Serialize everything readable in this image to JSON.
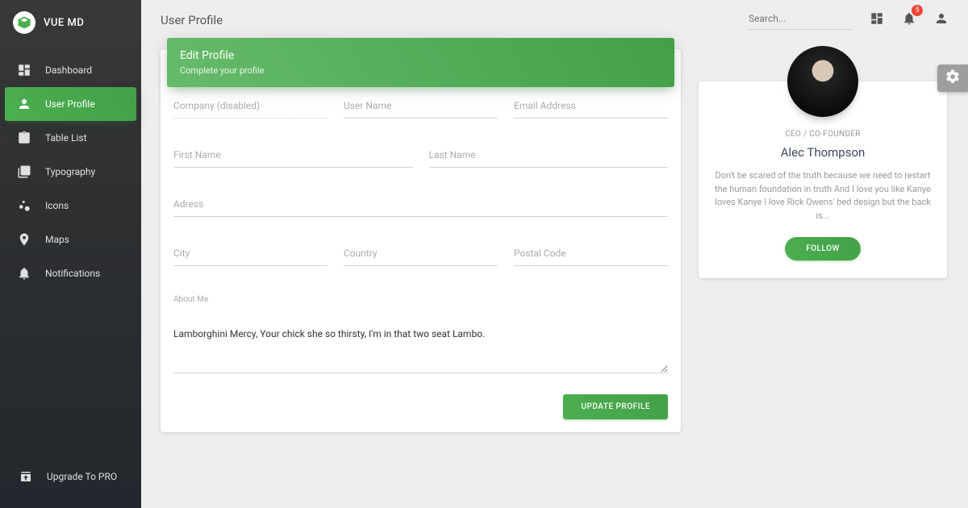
{
  "brand": {
    "name": "VUE MD"
  },
  "nav": {
    "items": [
      {
        "label": "Dashboard"
      },
      {
        "label": "User Profile"
      },
      {
        "label": "Table List"
      },
      {
        "label": "Typography"
      },
      {
        "label": "Icons"
      },
      {
        "label": "Maps"
      },
      {
        "label": "Notifications"
      }
    ],
    "upgrade": "Upgrade To PRO"
  },
  "topbar": {
    "title": "User Profile",
    "search_placeholder": "Search...",
    "notification_count": "5"
  },
  "form": {
    "header_title": "Edit Profile",
    "header_subtitle": "Complete your profile",
    "company_label": "Company (disabled)",
    "username_label": "User Name",
    "email_label": "Email Address",
    "firstname_label": "First Name",
    "lastname_label": "Last Name",
    "address_label": "Adress",
    "city_label": "City",
    "country_label": "Country",
    "postal_label": "Postal Code",
    "about_label": "About Me",
    "about_value": "Lamborghini Mercy, Your chick she so thirsty, I'm in that two seat Lambo.",
    "submit": "UPDATE PROFILE"
  },
  "profile": {
    "role": "CEO / CO-FOUNDER",
    "name": "Alec Thompson",
    "bio": "Don't be scared of the truth because we need to restart the human foundation in truth And I love you like Kanye loves Kanye I love Rick Owens' bed design but the back is...",
    "follow": "FOLLOW"
  }
}
